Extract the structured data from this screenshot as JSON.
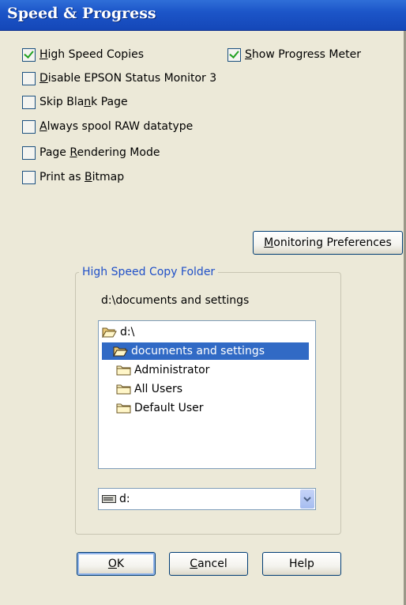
{
  "window": {
    "title": "Speed & Progress"
  },
  "options": {
    "high_speed_copies": {
      "label": "High Speed Copies",
      "checked": true
    },
    "show_progress_meter": {
      "label": "Show Progress Meter",
      "checked": true
    },
    "disable_status_monitor": {
      "label": "Disable EPSON Status Monitor 3",
      "checked": false
    },
    "skip_blank_page": {
      "label": "Skip Blank Page",
      "checked": false
    },
    "always_spool_raw": {
      "label": "Always spool RAW datatype",
      "checked": false
    },
    "page_rendering_mode": {
      "label": "Page Rendering Mode",
      "checked": false
    },
    "print_as_bitmap": {
      "label": "Print as Bitmap",
      "checked": false
    }
  },
  "monitoring_button": {
    "label": "Monitoring Preferences"
  },
  "folder_group": {
    "label": "High Speed Copy Folder",
    "current_path": "d:\\documents and settings",
    "tree": [
      {
        "label": "d:\\",
        "icon": "open-folder-icon",
        "selected": false
      },
      {
        "label": "documents and settings",
        "icon": "open-folder-icon",
        "selected": true
      },
      {
        "label": "Administrator",
        "icon": "folder-icon",
        "selected": false
      },
      {
        "label": "All Users",
        "icon": "folder-icon",
        "selected": false
      },
      {
        "label": "Default User",
        "icon": "folder-icon",
        "selected": false
      }
    ],
    "drive": {
      "value": "d:",
      "icon": "drive-icon"
    }
  },
  "buttons": {
    "ok": "OK",
    "cancel": "Cancel",
    "help": "Help"
  },
  "colors": {
    "titlebar": "#1c55c8",
    "selection": "#316ac5",
    "group_label": "#2050c8",
    "check": "#21a121"
  }
}
